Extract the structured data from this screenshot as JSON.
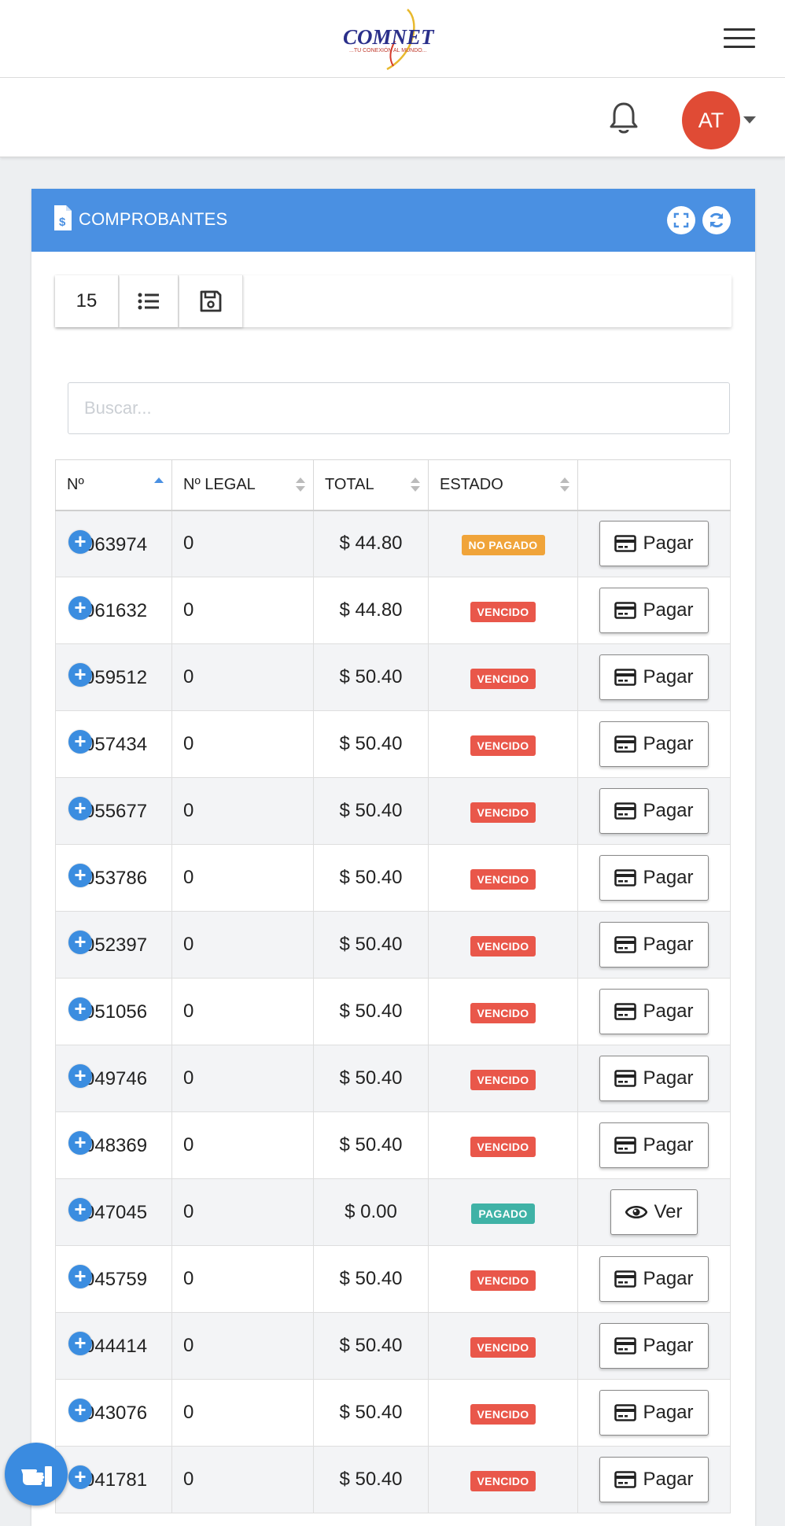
{
  "logo": {
    "text": "COMNET",
    "tagline": "...TU CONEXIÓN AL MUNDO..."
  },
  "user": {
    "initials": "AT"
  },
  "card": {
    "title": "COMPROBANTES"
  },
  "toolbar": {
    "page_size": "15"
  },
  "search": {
    "placeholder": "Buscar..."
  },
  "table": {
    "headers": [
      "Nº",
      "Nº LEGAL",
      "TOTAL",
      "ESTADO",
      ""
    ],
    "rows": [
      {
        "num": "063974",
        "legal": "0",
        "total": "$ 44.80",
        "estado": "NO PAGADO",
        "action": "Pagar"
      },
      {
        "num": "061632",
        "legal": "0",
        "total": "$ 44.80",
        "estado": "VENCIDO",
        "action": "Pagar"
      },
      {
        "num": "059512",
        "legal": "0",
        "total": "$ 50.40",
        "estado": "VENCIDO",
        "action": "Pagar"
      },
      {
        "num": "057434",
        "legal": "0",
        "total": "$ 50.40",
        "estado": "VENCIDO",
        "action": "Pagar"
      },
      {
        "num": "055677",
        "legal": "0",
        "total": "$ 50.40",
        "estado": "VENCIDO",
        "action": "Pagar"
      },
      {
        "num": "053786",
        "legal": "0",
        "total": "$ 50.40",
        "estado": "VENCIDO",
        "action": "Pagar"
      },
      {
        "num": "052397",
        "legal": "0",
        "total": "$ 50.40",
        "estado": "VENCIDO",
        "action": "Pagar"
      },
      {
        "num": "051056",
        "legal": "0",
        "total": "$ 50.40",
        "estado": "VENCIDO",
        "action": "Pagar"
      },
      {
        "num": "049746",
        "legal": "0",
        "total": "$ 50.40",
        "estado": "VENCIDO",
        "action": "Pagar"
      },
      {
        "num": "048369",
        "legal": "0",
        "total": "$ 50.40",
        "estado": "VENCIDO",
        "action": "Pagar"
      },
      {
        "num": "047045",
        "legal": "0",
        "total": "$ 0.00",
        "estado": "PAGADO",
        "action": "Ver"
      },
      {
        "num": "045759",
        "legal": "0",
        "total": "$ 50.40",
        "estado": "VENCIDO",
        "action": "Pagar"
      },
      {
        "num": "044414",
        "legal": "0",
        "total": "$ 50.40",
        "estado": "VENCIDO",
        "action": "Pagar"
      },
      {
        "num": "043076",
        "legal": "0",
        "total": "$ 50.40",
        "estado": "VENCIDO",
        "action": "Pagar"
      },
      {
        "num": "041781",
        "legal": "0",
        "total": "$ 50.40",
        "estado": "VENCIDO",
        "action": "Pagar"
      }
    ]
  },
  "colors": {
    "primary": "#4a90e2",
    "unpaid": "#f0a43a",
    "overdue": "#e9574a",
    "paid": "#3fb2a6",
    "avatar": "#e04b35"
  }
}
